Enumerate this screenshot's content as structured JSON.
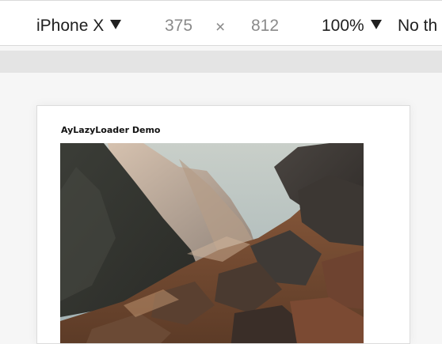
{
  "device_toolbar": {
    "device_label": "iPhone X",
    "width_value": "375",
    "times_symbol": "×",
    "height_value": "812",
    "zoom_label": "100%",
    "throttle_label": "No th"
  },
  "page": {
    "title": "AyLazyLoader Demo"
  },
  "colors": {
    "sky": "#b8c6c8",
    "rock_dark": "#2f302c",
    "rock_warm": "#7a5238",
    "highlight": "#d8b89a"
  }
}
